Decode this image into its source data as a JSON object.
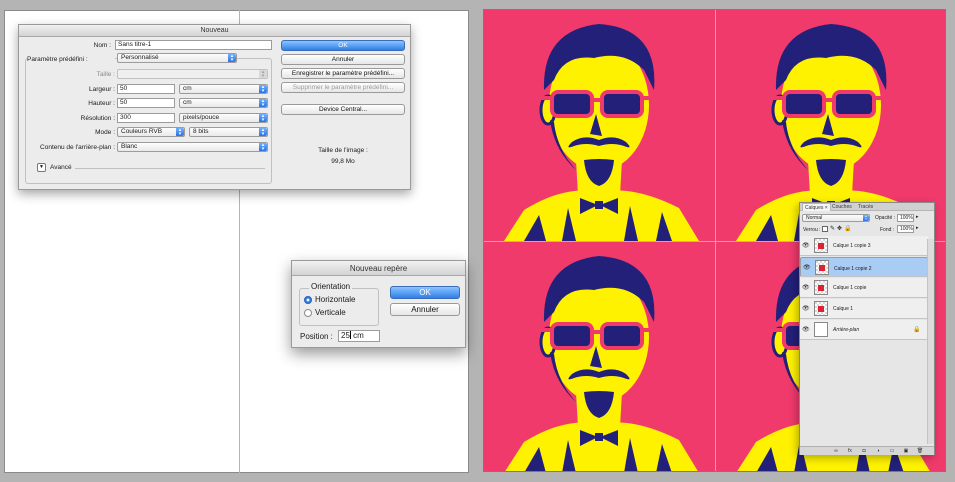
{
  "new_dialog": {
    "title": "Nouveau",
    "name_label": "Nom :",
    "name_value": "Sans titre-1",
    "preset_label": "Paramètre prédéfini :",
    "preset_value": "Personnalisé",
    "size_label": "Taille :",
    "width_label": "Largeur :",
    "width_value": "50",
    "width_unit": "cm",
    "height_label": "Hauteur :",
    "height_value": "50",
    "height_unit": "cm",
    "resolution_label": "Résolution :",
    "resolution_value": "300",
    "resolution_unit": "pixels/pouce",
    "mode_label": "Mode :",
    "mode_value": "Couleurs RVB",
    "bits_value": "8 bits",
    "background_label": "Contenu de l'arrière-plan :",
    "background_value": "Blanc",
    "advanced_label": "Avancé",
    "ok_label": "OK",
    "cancel_label": "Annuler",
    "save_preset_label": "Enregistrer le paramètre prédéfini...",
    "delete_preset_label": "Supprimer le paramètre prédéfini...",
    "device_central_label": "Device Central...",
    "image_size_label": "Taille de l'image :",
    "image_size_value": "99,8 Mo"
  },
  "guide_dialog": {
    "title": "Nouveau repère",
    "orientation_label": "Orientation",
    "horizontal_label": "Horizontale",
    "vertical_label": "Verticale",
    "position_label": "Position :",
    "position_value": "25",
    "position_unit": "cm",
    "ok_label": "OK",
    "cancel_label": "Annuler"
  },
  "layers_panel": {
    "tabs": [
      "Calques ×",
      "Couches",
      "Tracés"
    ],
    "blend_mode": "Normal",
    "opacity_label": "Opacité :",
    "opacity_value": "100%",
    "lock_label": "Verrou :",
    "fill_label": "Fond :",
    "fill_value": "100%",
    "layers": [
      {
        "name": "Calque 1 copie 3",
        "selected": false
      },
      {
        "name": "Calque 1 copie 2",
        "selected": true
      },
      {
        "name": "Calque 1 copie",
        "selected": false
      },
      {
        "name": "Calque 1",
        "selected": false
      },
      {
        "name": "Arrière-plan",
        "selected": false
      }
    ]
  },
  "colors": {
    "artwork_pink": "#f03a6c",
    "artwork_yellow": "#fff200",
    "artwork_navy": "#23207a",
    "guide_cyan": "#5cd6ec",
    "selection_blue": "#a8ccf3",
    "button_blue": "#2f7fe9"
  }
}
